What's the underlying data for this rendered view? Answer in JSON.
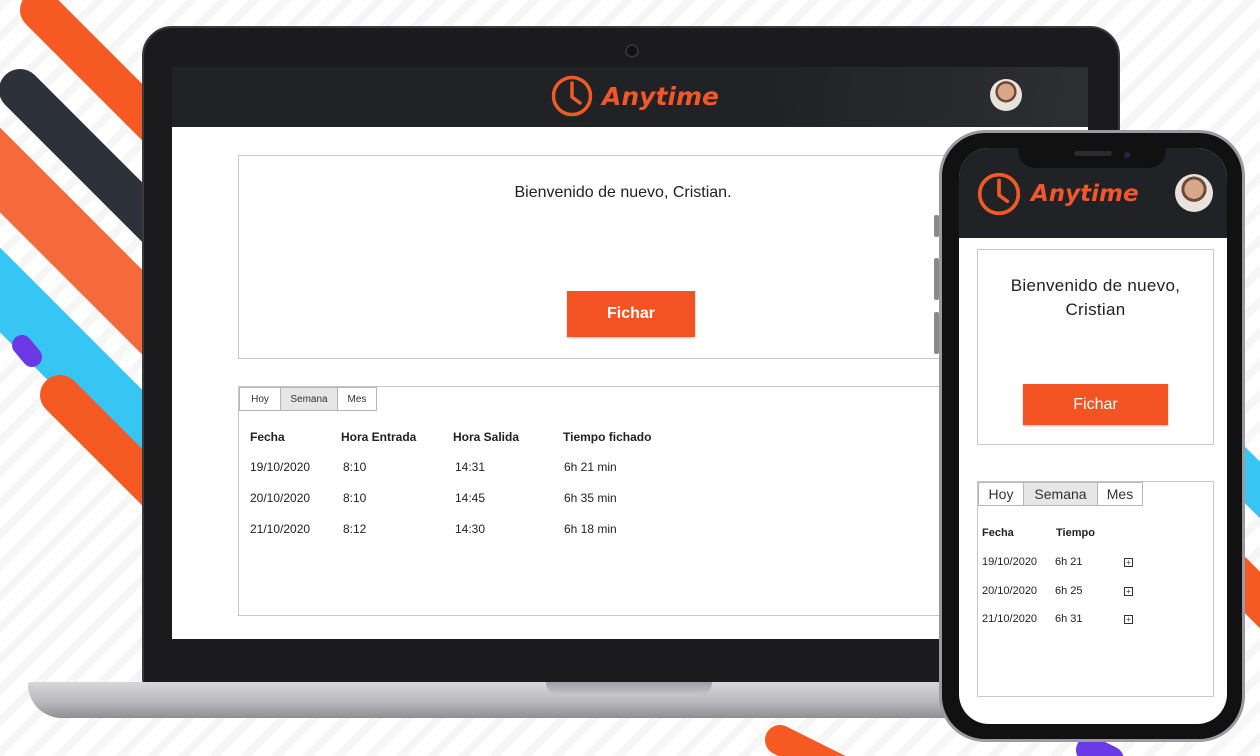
{
  "brand": {
    "name": "Anytime",
    "accent": "#f45424",
    "header_bg": "#202226"
  },
  "desktop": {
    "welcome": "Bienvenido de nuevo, Cristian.",
    "fichar_label": "Fichar",
    "tabs": [
      "Hoy",
      "Semana",
      "Mes"
    ],
    "active_tab": "Semana",
    "columns": [
      "Fecha",
      "Hora Entrada",
      "Hora Salida",
      "Tiempo fichado"
    ],
    "rows": [
      [
        "19/10/2020",
        "8:10",
        "14:31",
        "6h 21 min"
      ],
      [
        "20/10/2020",
        "8:10",
        "14:45",
        "6h 35 min"
      ],
      [
        "21/10/2020",
        "8:12",
        "14:30",
        "6h 18 min"
      ]
    ]
  },
  "mobile": {
    "welcome_line1": "Bienvenido de nuevo,",
    "welcome_line2": "Cristian",
    "fichar_label": "Fichar",
    "tabs": [
      "Hoy",
      "Semana",
      "Mes"
    ],
    "active_tab": "Semana",
    "columns": [
      "Fecha",
      "Tiempo"
    ],
    "rows": [
      [
        "19/10/2020",
        "6h 21"
      ],
      [
        "20/10/2020",
        "6h 25"
      ],
      [
        "21/10/2020",
        "6h 31"
      ]
    ]
  }
}
